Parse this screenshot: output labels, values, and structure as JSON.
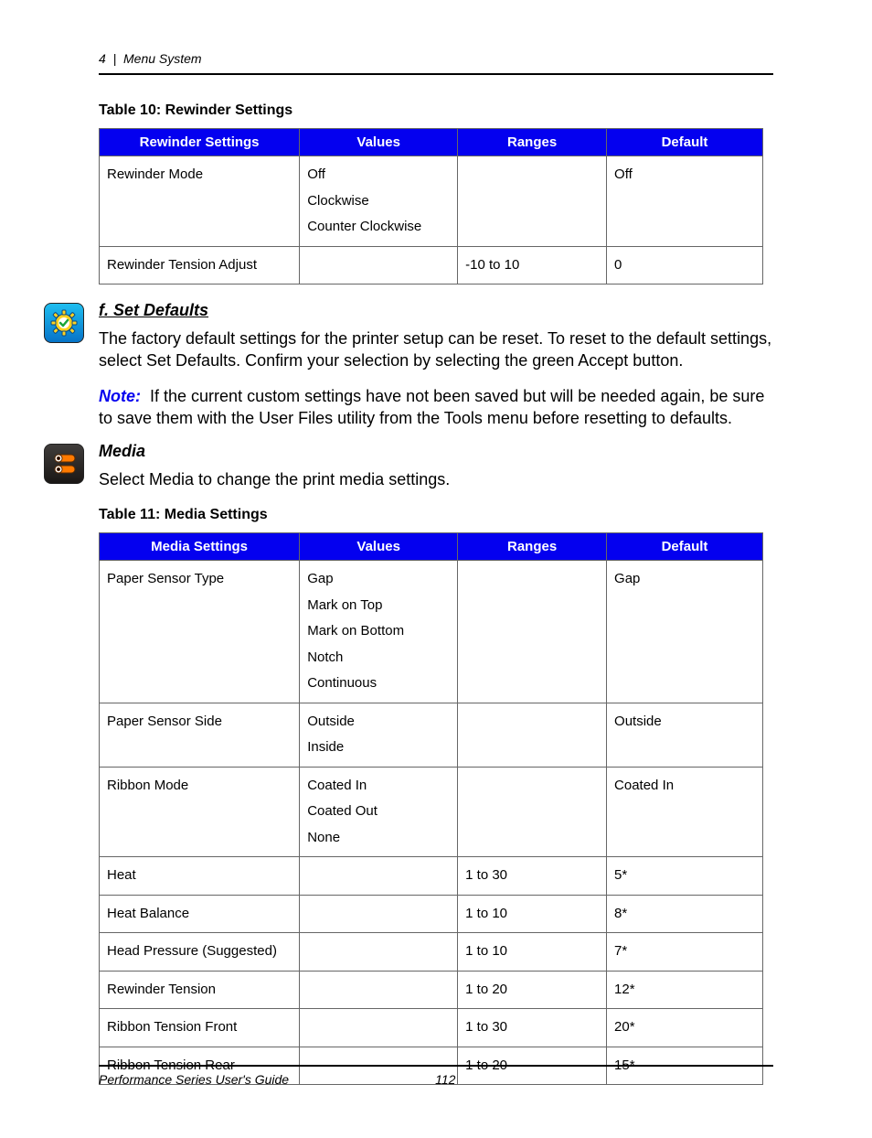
{
  "running_head": {
    "chapter": "4",
    "sep": "|",
    "title": "Menu System"
  },
  "table10": {
    "caption": "Table 10: Rewinder Settings",
    "headers": [
      "Rewinder Settings",
      "Values",
      "Ranges",
      "Default"
    ],
    "rows": [
      {
        "setting": "Rewinder Mode",
        "values": [
          "Off",
          "Clockwise",
          "Counter Clockwise"
        ],
        "ranges": "",
        "default": "Off"
      },
      {
        "setting": "Rewinder Tension Adjust",
        "values": [],
        "ranges": "-10 to 10",
        "default": "0"
      }
    ]
  },
  "section_f": {
    "heading": "f. Set Defaults",
    "p1": "The factory default settings for the printer setup can be reset. To reset to the default settings, select Set Defaults. Confirm your selection by selecting the green Accept button.",
    "note_label": "Note:",
    "note_body": "If the current custom settings have not been saved but will be needed again, be sure to save them with the User Files utility from the Tools menu before resetting to defaults."
  },
  "section_media": {
    "heading": "Media",
    "p1": "Select Media to change the print media settings."
  },
  "table11": {
    "caption": "Table 11: Media Settings",
    "headers": [
      "Media Settings",
      "Values",
      "Ranges",
      "Default"
    ],
    "rows": [
      {
        "setting": "Paper Sensor Type",
        "values": [
          "Gap",
          "Mark on Top",
          "Mark on Bottom",
          "Notch",
          "Continuous"
        ],
        "ranges": "",
        "default": "Gap"
      },
      {
        "setting": "Paper Sensor Side",
        "values": [
          "Outside",
          "Inside"
        ],
        "ranges": "",
        "default": "Outside"
      },
      {
        "setting": "Ribbon Mode",
        "values": [
          "Coated In",
          "Coated Out",
          "None"
        ],
        "ranges": "",
        "default": "Coated In"
      },
      {
        "setting": "Heat",
        "values": [],
        "ranges": "1 to 30",
        "default": "5*"
      },
      {
        "setting": "Heat Balance",
        "values": [],
        "ranges": "1 to 10",
        "default": "8*"
      },
      {
        "setting": "Head Pressure (Suggested)",
        "values": [],
        "ranges": "1 to 10",
        "default": "7*"
      },
      {
        "setting": "Rewinder Tension",
        "values": [],
        "ranges": "1 to 20",
        "default": "12*"
      },
      {
        "setting": "Ribbon Tension Front",
        "values": [],
        "ranges": "1 to 30",
        "default": "20*"
      },
      {
        "setting": "Ribbon Tension Rear",
        "values": [],
        "ranges": "1 to 20",
        "default": "15*"
      }
    ]
  },
  "footer": {
    "title": "Performance Series User's Guide",
    "page": "112"
  }
}
